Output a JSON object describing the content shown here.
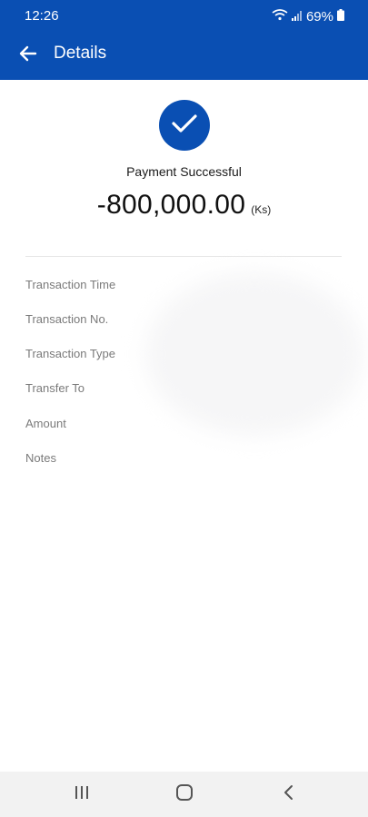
{
  "status_bar": {
    "time": "12:26",
    "battery": "69%",
    "icons": [
      "wifi-icon",
      "signal-icon",
      "battery-icon"
    ]
  },
  "app_bar": {
    "title": "Details",
    "back_icon": "arrow-left-icon"
  },
  "payment": {
    "status_icon": "check-icon",
    "status_text": "Payment Successful",
    "amount": "-800,000.00",
    "currency": "(Ks)"
  },
  "details": {
    "labels": [
      "Transaction Time",
      "Transaction No.",
      "Transaction Type",
      "Transfer To",
      "Amount",
      "Notes"
    ]
  },
  "nav_bar": {
    "icons": [
      "recent-apps-icon",
      "home-icon",
      "back-icon"
    ]
  },
  "colors": {
    "primary": "#0a4fb3",
    "label_gray": "#7a7a7a",
    "nav_bg": "#f2f2f2"
  }
}
